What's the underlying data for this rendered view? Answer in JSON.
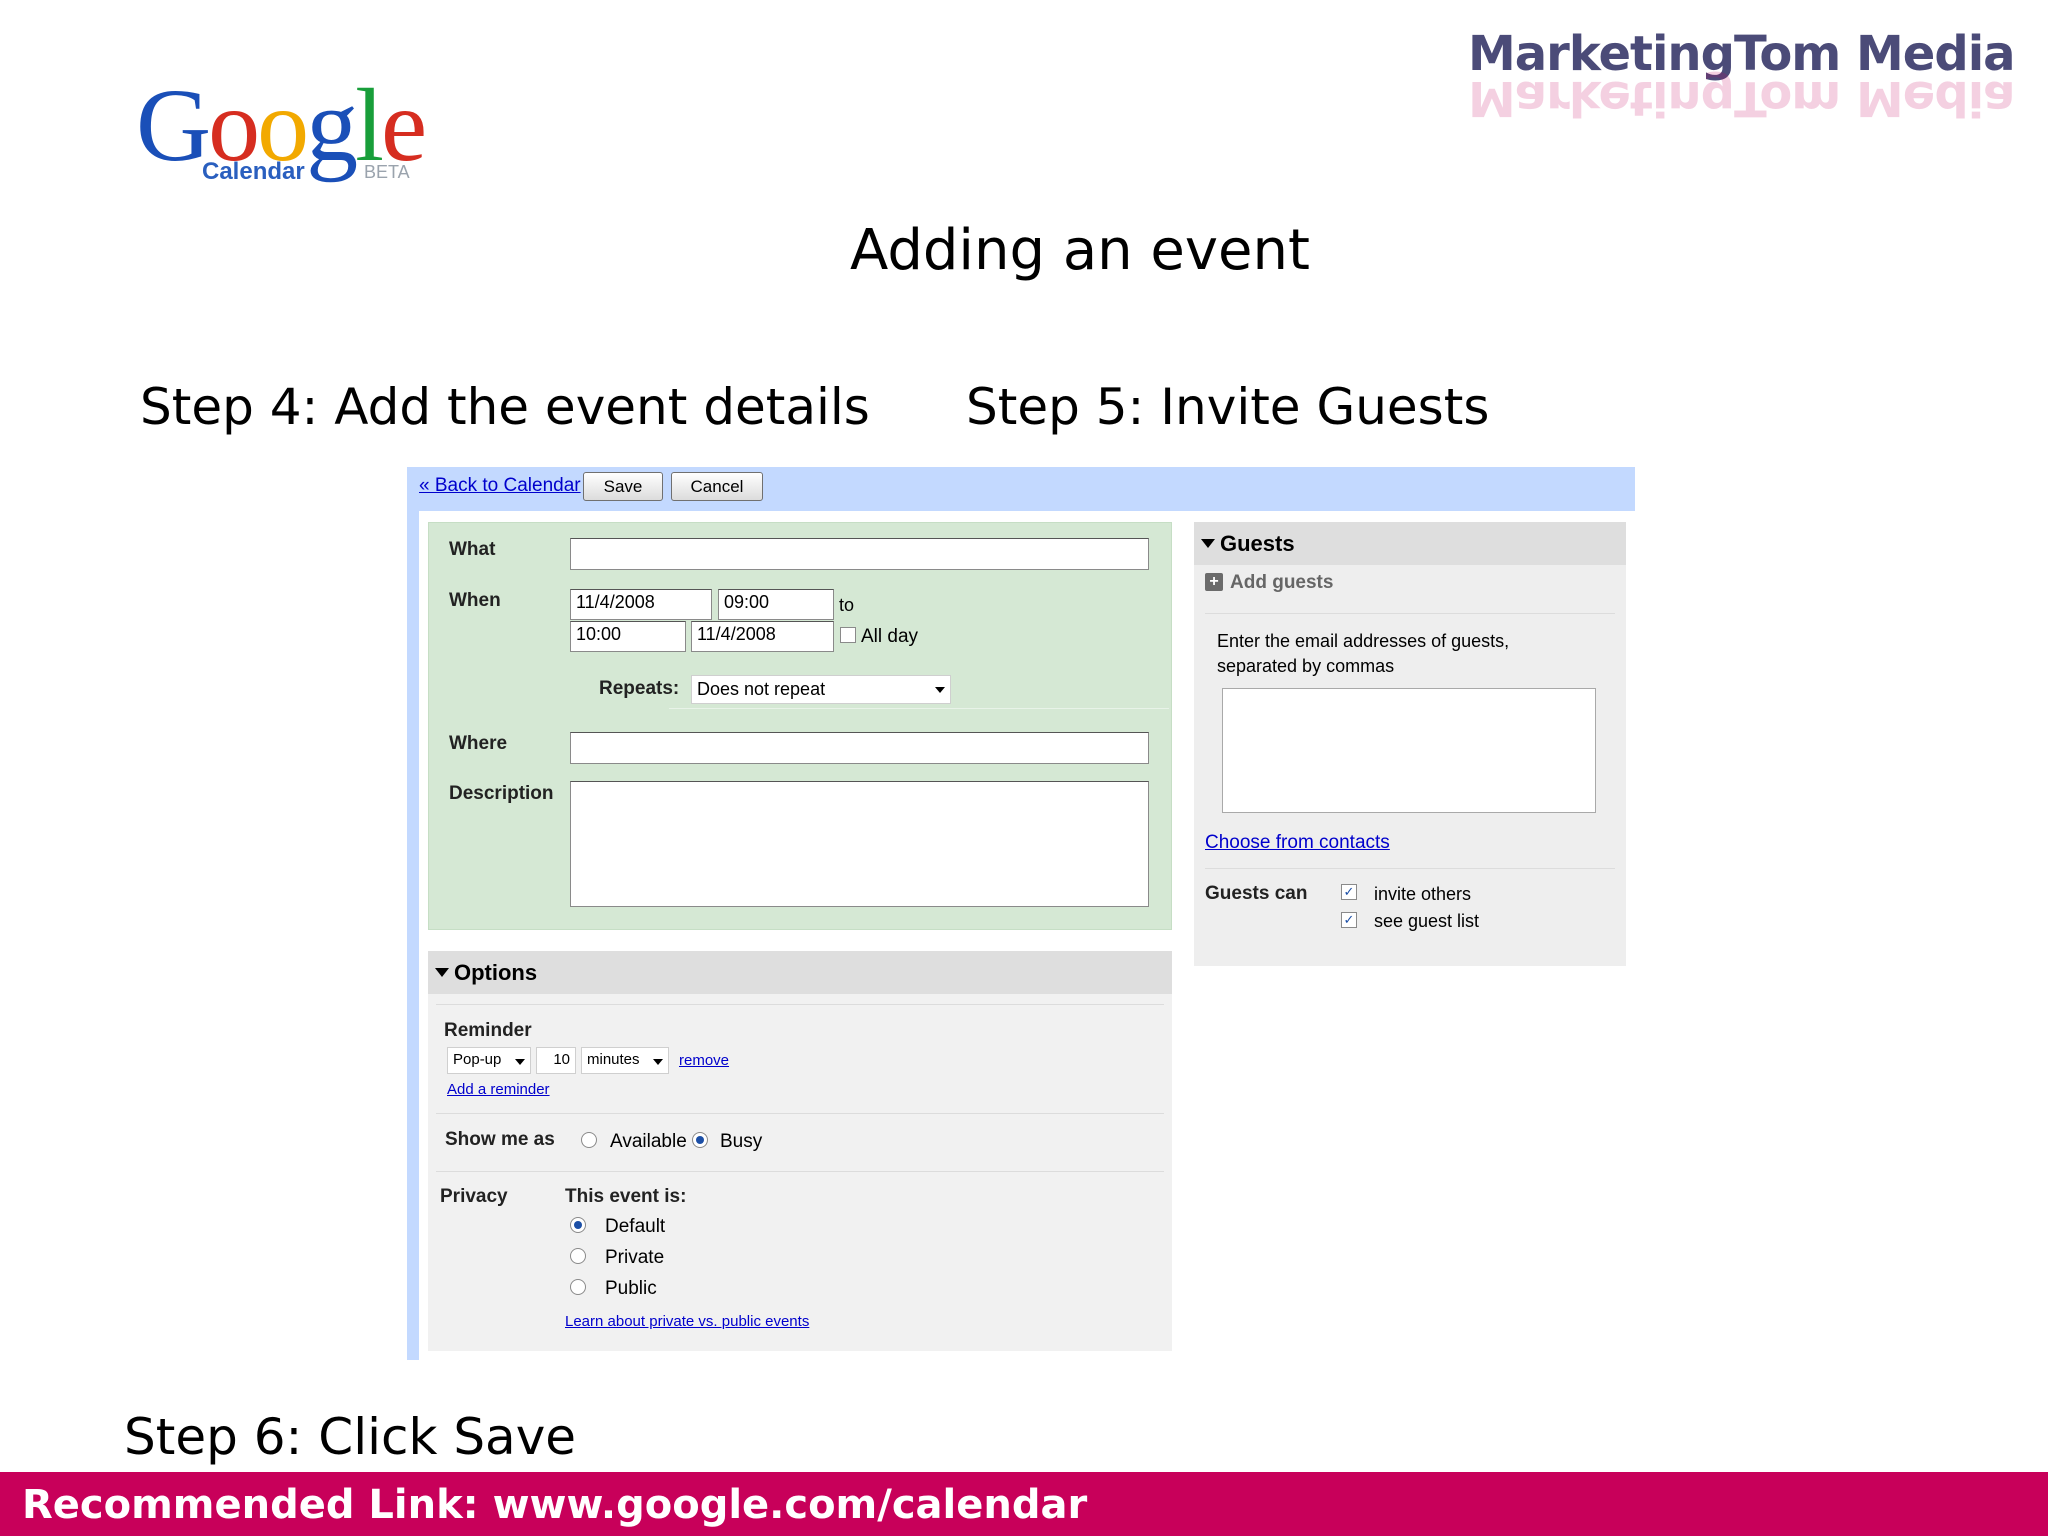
{
  "slide": {
    "title": "Adding an event",
    "step4": "Step 4: Add the event details",
    "step5": "Step 5: Invite Guests",
    "step6": "Step 6: Click Save",
    "footer": "Recommended Link: www.google.com/calendar",
    "accent_color": "#c8005a"
  },
  "logos": {
    "google": {
      "letters": [
        "G",
        "o",
        "o",
        "g",
        "l",
        "e"
      ],
      "sub": "Calendar",
      "beta": "BETA"
    },
    "brand": "MarketingTom  Media"
  },
  "toolbar": {
    "back_link": "« Back to Calendar",
    "save_label": "Save",
    "cancel_label": "Cancel"
  },
  "details": {
    "what_label": "What",
    "what_value": "",
    "when_label": "When",
    "start_date": "11/4/2008",
    "start_time": "09:00",
    "to_label": "to",
    "end_time": "10:00",
    "end_date": "11/4/2008",
    "all_day_label": "All day",
    "repeats_label": "Repeats:",
    "repeats_value": "Does not repeat",
    "where_label": "Where",
    "where_value": "",
    "description_label": "Description",
    "description_value": ""
  },
  "options": {
    "header": "Options",
    "reminder_label": "Reminder",
    "reminder_type": "Pop-up",
    "reminder_amount": "10",
    "reminder_unit": "minutes",
    "remove_link": "remove",
    "add_reminder_link": "Add a reminder",
    "show_me_as_label": "Show me as",
    "available_label": "Available",
    "busy_label": "Busy",
    "show_me_as_selected": "Busy",
    "privacy_label": "Privacy",
    "privacy_heading": "This event is:",
    "privacy_options": [
      "Default",
      "Private",
      "Public"
    ],
    "privacy_selected": "Default",
    "learn_link": "Learn about private vs. public events"
  },
  "guests": {
    "header": "Guests",
    "add_guests_label": "Add guests",
    "instructions_line1": "Enter the email addresses of guests,",
    "instructions_line2": "separated by commas",
    "emails_value": "",
    "choose_contacts_link": "Choose from contacts",
    "guests_can_label": "Guests can",
    "invite_others_label": "invite others",
    "invite_others_checked": true,
    "see_guest_list_label": "see guest list",
    "see_guest_list_checked": true
  }
}
